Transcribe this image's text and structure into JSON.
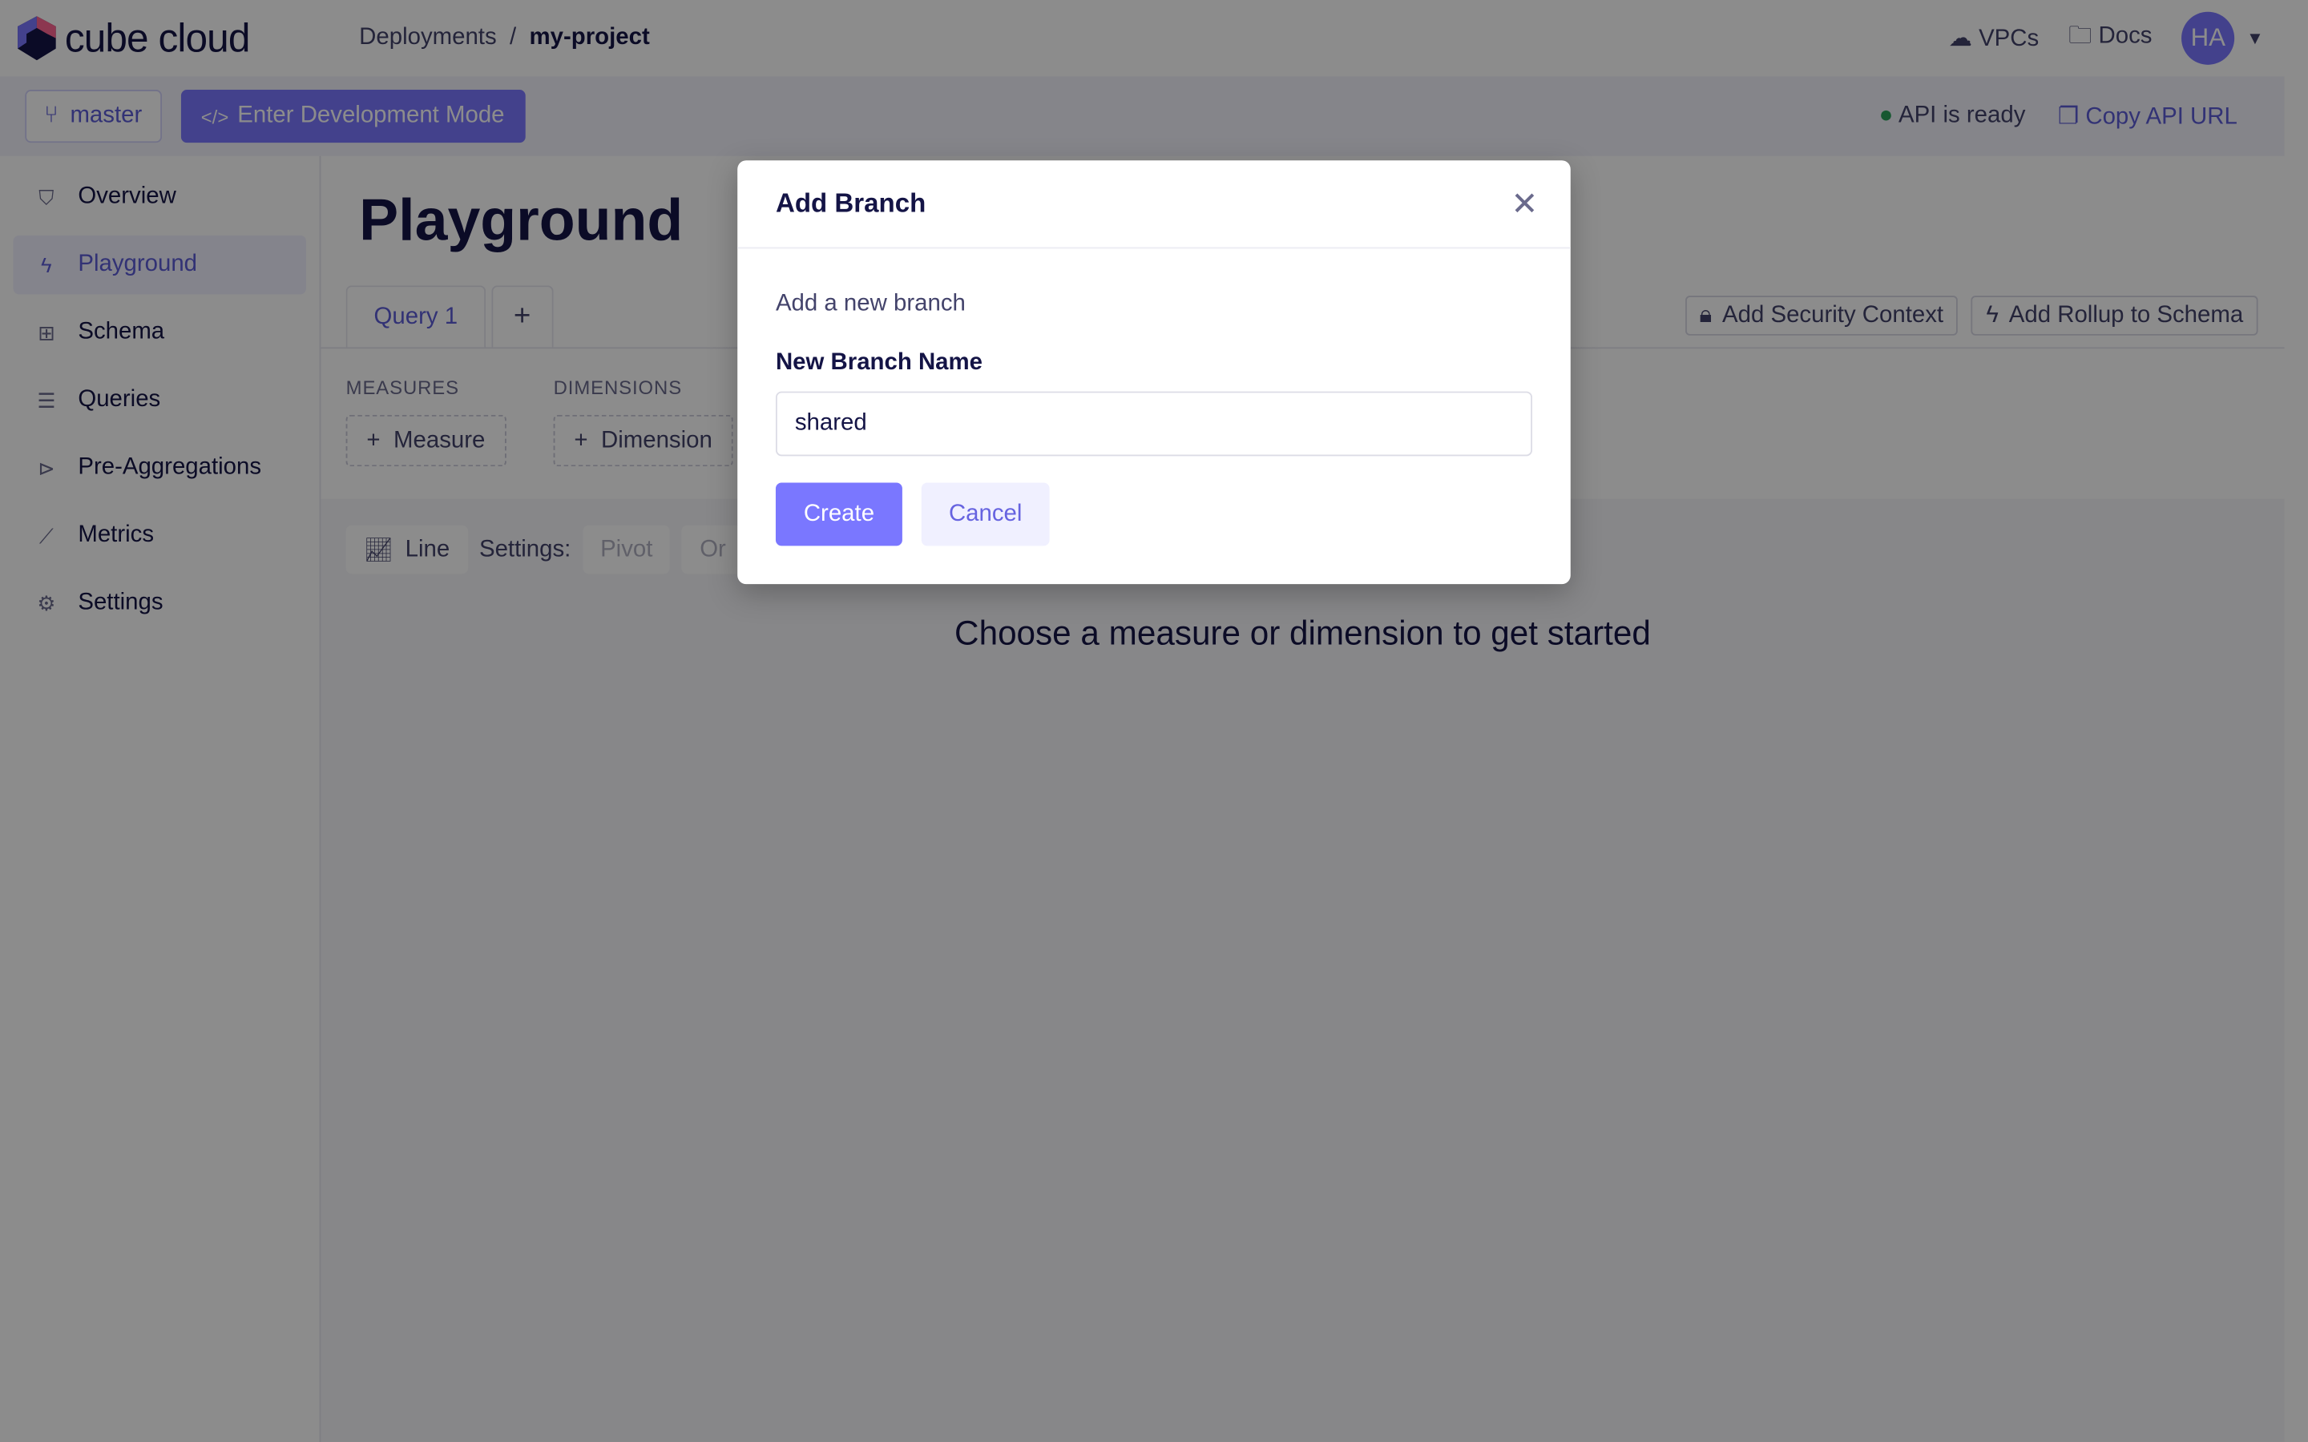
{
  "header": {
    "logo": "cube cloud",
    "breadcrumb": [
      "Deployments",
      "my-project"
    ],
    "links": [
      {
        "icon": "cloud-icon",
        "label": "VPCs"
      },
      {
        "icon": "folder-icon",
        "label": "Docs"
      }
    ],
    "avatar": "HA"
  },
  "toolbar": {
    "branch": "master",
    "dev_mode": "Enter Development Mode",
    "status": "API is ready",
    "copy_url": "Copy API URL"
  },
  "sidebar": {
    "items": [
      {
        "label": "Overview",
        "icon": "shield-icon"
      },
      {
        "label": "Playground",
        "icon": "lightning-icon",
        "active": true
      },
      {
        "label": "Schema",
        "icon": "schema-icon"
      },
      {
        "label": "Queries",
        "icon": "list-icon"
      },
      {
        "label": "Pre-Aggregations",
        "icon": "terminal-icon"
      },
      {
        "label": "Metrics",
        "icon": "chart-icon"
      },
      {
        "label": "Settings",
        "icon": "gear-icon"
      }
    ]
  },
  "main": {
    "title": "Playground",
    "tabs": [
      {
        "label": "Query 1"
      }
    ],
    "add_tab": "+",
    "actions": [
      "Add Security Context",
      "Add Rollup to Schema"
    ],
    "measures_label": "MEASURES",
    "dimensions_label": "DIMENSIONS",
    "measure_btn": "Measure",
    "dimension_btn": "Dimension",
    "chart_type": "Line",
    "settings_label": "Settings:",
    "settings": [
      "Pivot",
      "Or"
    ],
    "empty": "Choose a measure or dimension to get started"
  },
  "modal": {
    "title": "Add Branch",
    "subtitle": "Add a new branch",
    "field_label": "New Branch Name",
    "field_value": "shared",
    "create": "Create",
    "cancel": "Cancel"
  },
  "colors": {
    "accent": "#7a77ff",
    "status_ok": "#2aa05a"
  }
}
